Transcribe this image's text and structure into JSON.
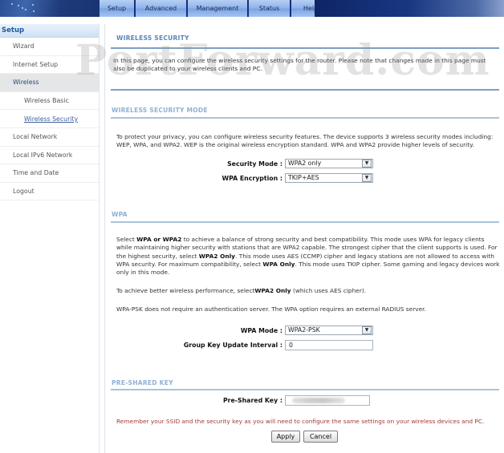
{
  "top_nav": {
    "tabs": [
      {
        "label": "Setup",
        "active": true
      },
      {
        "label": "Advanced",
        "active": false
      },
      {
        "label": "Management",
        "active": false
      },
      {
        "label": "Status",
        "active": false
      },
      {
        "label": "Help",
        "active": false
      }
    ]
  },
  "sidebar": {
    "header": "Setup",
    "items": [
      {
        "label": "Wizard"
      },
      {
        "label": "Internet Setup"
      },
      {
        "label": "Wireless"
      },
      {
        "label": "Wireless Basic"
      },
      {
        "label": "Wireless Security"
      },
      {
        "label": "Local Network"
      },
      {
        "label": "Local IPv6 Network"
      },
      {
        "label": "Time and Date"
      },
      {
        "label": "Logout"
      }
    ]
  },
  "watermark": "PortForward.com",
  "main": {
    "wireless_security": {
      "title": "WIRELESS SECURITY",
      "description": "In this page, you can configure the wireless security settings for the router. Please note that changes made in this page must also be duplicated to your wireless clients and PC."
    },
    "security_mode_section": {
      "title": "WIRELESS SECURITY MODE",
      "description": "To protect your privacy, you can configure wireless security features. The device supports 3 wireless security modes including: WEP, WPA, and WPA2. WEP is the original wireless encryption standard. WPA and WPA2 provide higher levels of security.",
      "security_mode_label": "Security Mode :",
      "security_mode_value": "WPA2 only",
      "wpa_encryption_label": "WPA Encryption :",
      "wpa_encryption_value": "TKIP+AES"
    },
    "wpa_section": {
      "title": "WPA",
      "p1_a": "Select ",
      "p1_b1": "WPA or WPA2",
      "p1_c": " to achieve a balance of strong security and best compatibility. This mode uses WPA for legacy clients while maintaining higher security with stations that are WPA2 capable. The strongest cipher that the client supports is used. For the highest security, select ",
      "p1_b2": "WPA2 Only",
      "p1_d": ". This mode uses AES (CCMP) cipher and legacy stations are not allowed to access with WPA security. For maximum compatibility, select ",
      "p1_b3": "WPA Only",
      "p1_e": ". This mode uses TKIP cipher. Some gaming and legacy devices work only in this mode.",
      "p2_a": "To achieve better wireless performance, select",
      "p2_b": "WPA2 Only",
      "p2_c": " (which uses AES cipher).",
      "p3": "WPA-PSK does not require an authentication server. The WPA option requires an external RADIUS server.",
      "wpa_mode_label": "WPA Mode :",
      "wpa_mode_value": "WPA2-PSK",
      "group_key_label": "Group Key Update Interval :",
      "group_key_value": "0"
    },
    "psk_section": {
      "title": "PRE-SHARED KEY",
      "psk_label": "Pre-Shared Key :",
      "psk_value_state": "blurred",
      "reminder": "Remember your SSID and the security key as you will need to configure the same settings on your wireless devices and PC.",
      "apply_label": "Apply",
      "cancel_label": "Cancel"
    }
  }
}
